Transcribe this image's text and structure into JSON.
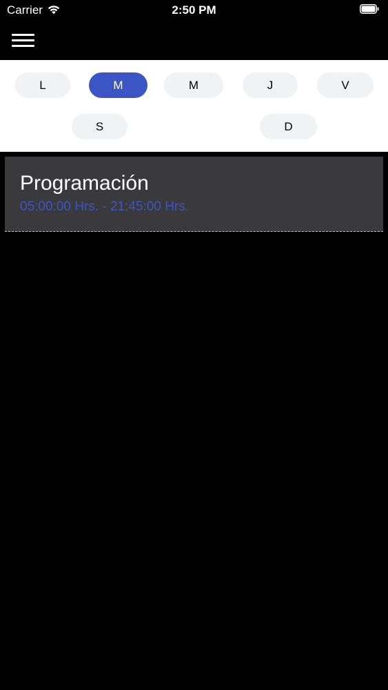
{
  "status_bar": {
    "carrier": "Carrier",
    "time": "2:50 PM",
    "wifi_icon": "wifi-icon",
    "battery_icon": "battery-icon"
  },
  "nav": {
    "menu_icon": "hamburger-menu-icon"
  },
  "days": [
    {
      "label": "L",
      "selected": false
    },
    {
      "label": "M",
      "selected": true
    },
    {
      "label": "M",
      "selected": false
    },
    {
      "label": "J",
      "selected": false
    },
    {
      "label": "V",
      "selected": false
    },
    {
      "label": "S",
      "selected": false
    },
    {
      "label": "D",
      "selected": false
    }
  ],
  "schedule": {
    "title": "Programación",
    "hours": "05:00:00 Hrs. - 21:45:00 Hrs."
  },
  "colors": {
    "accent": "#3b55c4",
    "card_background": "#3a393c",
    "pill_background": "#f1f2f4",
    "background": "#000000"
  }
}
